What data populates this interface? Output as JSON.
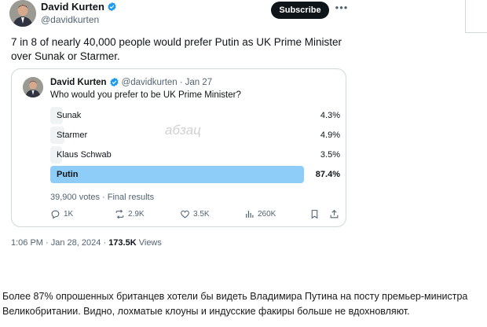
{
  "author": {
    "display_name": "David Kurten",
    "handle": "@davidkurten"
  },
  "header": {
    "subscribe_label": "Subscribe",
    "more_icon": "more-horizontal-icon"
  },
  "tweet": {
    "text": "7 in 8 of nearly 40,000 people would prefer Putin as UK Prime Minister over Sunak or Starmer.",
    "time": "1:06 PM",
    "date": "Jan 28, 2024",
    "views_count": "173.5K",
    "views_label": "Views"
  },
  "quote": {
    "display_name": "David Kurten",
    "handle": "@davidkurten",
    "date": "Jan 27",
    "question": "Who would you prefer to be UK Prime Minister?",
    "watermark": "абзац",
    "poll": {
      "options": [
        {
          "label": "Sunak",
          "percent_text": "4.3%",
          "percent": 4.3,
          "winner": false
        },
        {
          "label": "Starmer",
          "percent_text": "4.9%",
          "percent": 4.9,
          "winner": false
        },
        {
          "label": "Klaus Schwab",
          "percent_text": "3.5%",
          "percent": 3.5,
          "winner": false
        },
        {
          "label": "Putin",
          "percent_text": "87.4%",
          "percent": 87.4,
          "winner": true
        }
      ],
      "summary": "39,900 votes · Final results"
    },
    "actions": {
      "replies": "1K",
      "reposts": "2.9K",
      "likes": "3.5K",
      "views": "260K"
    }
  },
  "caption": {
    "text": "Более 87% опрошенных британцев хотели бы видеть Владимира Путина на посту премьер-министра Великобритании. Видно, лохматые клоуны и индусские факиры больше не вдохновляют."
  },
  "colors": {
    "verified": "#1d9bf0",
    "winner_bar": "#8ecdf8",
    "bar": "#eff3f4"
  }
}
